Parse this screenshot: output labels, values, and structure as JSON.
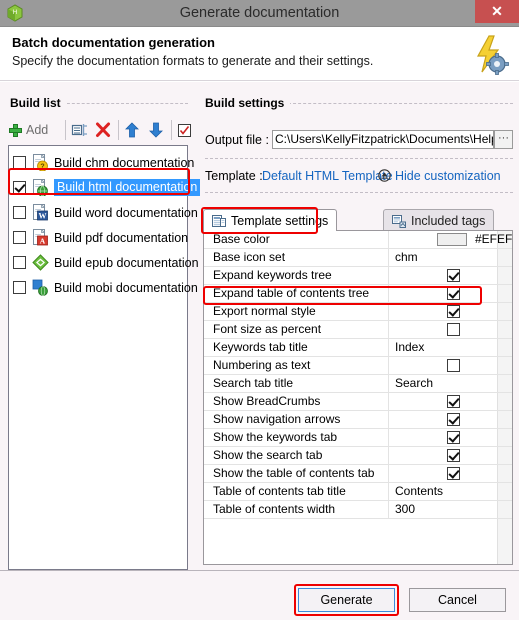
{
  "window": {
    "title": "Generate documentation",
    "app_icon": "helpndoc-cube-icon",
    "close_label": "✕"
  },
  "header": {
    "title": "Batch documentation generation",
    "subtitle": "Specify the documentation formats to generate and their settings.",
    "icon": "lightning-gear-icon"
  },
  "build_list": {
    "group_label": "Build list",
    "toolbar": {
      "add_label": "Add",
      "add_icon": "plus-icon",
      "duplicate_icon": "duplicate-icon",
      "delete_icon": "red-x-icon",
      "move_up_icon": "arrow-up-icon",
      "move_down_icon": "arrow-down-icon",
      "check_all_icon": "check-all-icon"
    },
    "items": [
      {
        "label": "Build chm documentation",
        "checked": false,
        "selected": false,
        "icon": "chm-doc-icon"
      },
      {
        "label": "Build html documentation",
        "checked": true,
        "selected": true,
        "icon": "html-doc-icon"
      },
      {
        "label": "Build word documentation",
        "checked": false,
        "selected": false,
        "icon": "word-doc-icon"
      },
      {
        "label": "Build pdf documentation",
        "checked": false,
        "selected": false,
        "icon": "pdf-doc-icon"
      },
      {
        "label": "Build epub documentation",
        "checked": false,
        "selected": false,
        "icon": "epub-doc-icon"
      },
      {
        "label": "Build mobi documentation",
        "checked": false,
        "selected": false,
        "icon": "mobi-doc-icon"
      }
    ]
  },
  "build_settings": {
    "group_label": "Build settings",
    "output_file_label": "Output file :",
    "output_file_value": "C:\\Users\\KellyFitzpatrick\\Documents\\HelpNDo",
    "browse_label": "···",
    "template_label": "Template :",
    "template_value": "Default HTML Template",
    "hide_customization_label": "Hide customization",
    "hide_customization_icon": "collapse-circle-icon",
    "tabs": [
      {
        "label": "Template settings",
        "icon": "template-settings-icon",
        "active": true
      },
      {
        "label": "Included tags",
        "icon": "tags-icon",
        "active": false
      }
    ],
    "settings_rows": [
      {
        "name": "Base color",
        "type": "color",
        "value": "#EFEFEF",
        "swatch": "#efefef"
      },
      {
        "name": "Base icon set",
        "type": "text",
        "value": "chm"
      },
      {
        "name": "Expand keywords tree",
        "type": "checkbox",
        "checked": true
      },
      {
        "name": "Expand table of contents tree",
        "type": "checkbox",
        "checked": true,
        "highlighted": true
      },
      {
        "name": "Export normal style",
        "type": "checkbox",
        "checked": true
      },
      {
        "name": "Font size as percent",
        "type": "checkbox",
        "checked": false
      },
      {
        "name": "Keywords tab title",
        "type": "text",
        "value": "Index"
      },
      {
        "name": "Numbering as text",
        "type": "checkbox",
        "checked": false
      },
      {
        "name": "Search tab title",
        "type": "text",
        "value": "Search"
      },
      {
        "name": "Show BreadCrumbs",
        "type": "checkbox",
        "checked": true
      },
      {
        "name": "Show navigation arrows",
        "type": "checkbox",
        "checked": true
      },
      {
        "name": "Show the keywords tab",
        "type": "checkbox",
        "checked": true
      },
      {
        "name": "Show the search tab",
        "type": "checkbox",
        "checked": true
      },
      {
        "name": "Show the table of contents tab",
        "type": "checkbox",
        "checked": true
      },
      {
        "name": "Table of contents tab title",
        "type": "text",
        "value": "Contents"
      },
      {
        "name": "Table of contents width",
        "type": "text",
        "value": "300"
      }
    ]
  },
  "footer": {
    "generate_label": "Generate",
    "cancel_label": "Cancel"
  },
  "colors": {
    "titlebar": "#9a9a9a",
    "close_button": "#c75050",
    "content_bg": "#f9f4f7",
    "selection": "#3399ff",
    "link": "#1565c0",
    "annotation": "#ee0000"
  }
}
